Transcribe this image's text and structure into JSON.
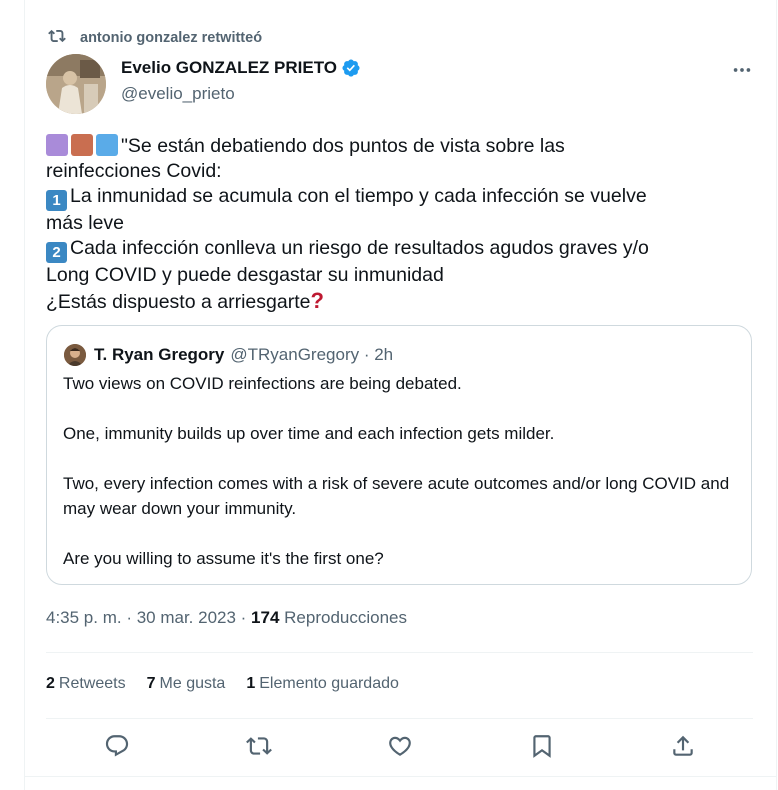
{
  "retweet_context": {
    "text": "antonio gonzalez retwitteó"
  },
  "author": {
    "name": "Evelio GONZALEZ PRIETO",
    "handle": "@evelio_prieto"
  },
  "tweet": {
    "line1": "\"Se están debatiendo dos puntos de vista sobre las",
    "line2": "reinfecciones Covid:",
    "line3": "La inmunidad se acumula con el tiempo y cada infección se vuelve",
    "line4": "más leve",
    "line5": "Cada infección conlleva un riesgo de resultados agudos graves y/o",
    "line6": "Long COVID y puede desgastar su inmunidad",
    "line7": "¿Estás dispuesto a arriesgarte",
    "keycap1": "1",
    "keycap2": "2",
    "emoji_colors": [
      "#a98bd9",
      "#c96e50",
      "#5aabe8"
    ]
  },
  "quote": {
    "name": "T. Ryan Gregory",
    "handle": "@TRyanGregory · 2h",
    "p1": "Two views on COVID reinfections are being debated.",
    "p2": "One, immunity builds up over time and each infection gets milder.",
    "p3": "Two, every infection comes with a risk of severe acute outcomes and/or long COVID and may wear down your immunity.",
    "p4": "Are you willing to assume it's the first one?"
  },
  "meta": {
    "time": "4:35 p. m. · 30 mar. 2023 · ",
    "views_count": "174",
    "views_label": " Reproducciones"
  },
  "stats": {
    "retweets_count": "2",
    "retweets_label": "Retweets",
    "likes_count": "7",
    "likes_label": "Me gusta",
    "bookmarks_count": "1",
    "bookmarks_label": "Elemento guardado"
  },
  "colors": {
    "accent": "#1d9bf0",
    "muted": "#536471",
    "text": "#0f1419"
  },
  "icons": [
    "retweet-icon",
    "verified-icon",
    "more-icon",
    "reply-icon",
    "like-icon",
    "bookmark-icon",
    "share-icon"
  ]
}
